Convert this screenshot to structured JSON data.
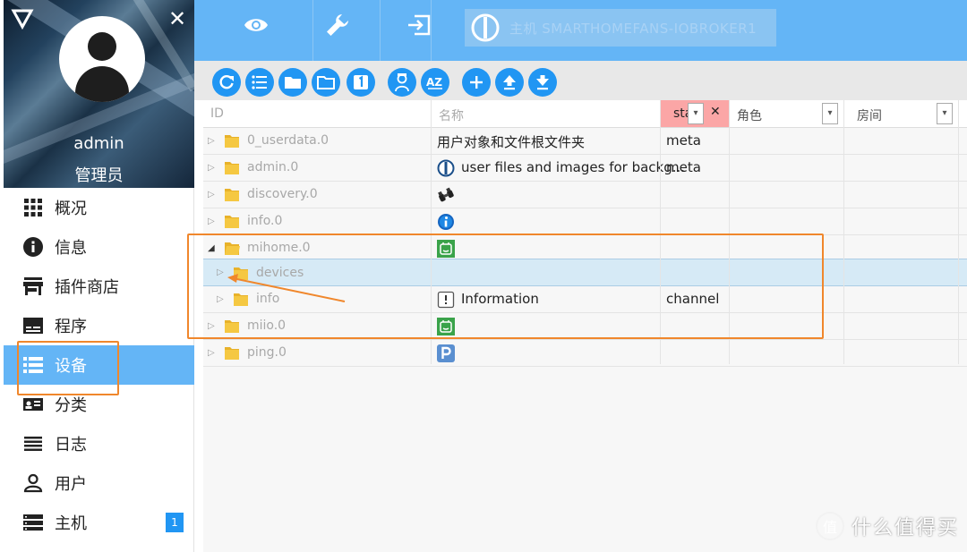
{
  "sidebar": {
    "user_name": "admin",
    "user_role": "管理员",
    "items": [
      {
        "label": "概况",
        "icon": "apps-grid-icon"
      },
      {
        "label": "信息",
        "icon": "info-icon"
      },
      {
        "label": "插件商店",
        "icon": "store-icon"
      },
      {
        "label": "程序",
        "icon": "instances-icon"
      },
      {
        "label": "设备",
        "icon": "list-icon",
        "active": true
      },
      {
        "label": "分类",
        "icon": "categories-icon"
      },
      {
        "label": "日志",
        "icon": "log-icon"
      },
      {
        "label": "用户",
        "icon": "user-icon"
      },
      {
        "label": "主机",
        "icon": "hosts-icon",
        "badge": "1"
      }
    ]
  },
  "topbar": {
    "host_label": "主机 SMARTHOMEFANS-IOBROKER1",
    "accent": "#64b5f6"
  },
  "toolbar": {
    "buttons": [
      "refresh-icon",
      "list-view-icon",
      "folder-closed-icon",
      "folder-open-icon",
      "one-icon",
      "expert-mode-icon",
      "sort-az-icon",
      "add-icon",
      "upload-icon",
      "download-icon"
    ]
  },
  "table": {
    "headers": {
      "id": "ID",
      "name": "名称",
      "state": "sta",
      "role": "角色",
      "room": "房间"
    },
    "rows": [
      {
        "id": "0_userdata.0",
        "name": "用户对象和文件根文件夹",
        "role": "meta",
        "icon": ""
      },
      {
        "id": "admin.0",
        "name": "user files and images for backg...",
        "role": "meta",
        "icon": "iobroker-icon"
      },
      {
        "id": "discovery.0",
        "name": "",
        "role": "",
        "icon": "binoculars-icon"
      },
      {
        "id": "info.0",
        "name": "",
        "role": "",
        "icon": "info-adapter-icon"
      },
      {
        "id": "mihome.0",
        "name": "",
        "role": "",
        "icon": "mihome-icon"
      },
      {
        "id": "devices",
        "name": "",
        "role": "",
        "icon": ""
      },
      {
        "id": "info",
        "name": "Information",
        "role": "channel",
        "icon": "information-channel-icon"
      },
      {
        "id": "miio.0",
        "name": "",
        "role": "",
        "icon": "miio-icon"
      },
      {
        "id": "ping.0",
        "name": "",
        "role": "",
        "icon": "ping-icon"
      }
    ]
  },
  "watermark": {
    "symbol": "值",
    "text": "什么值得买"
  }
}
